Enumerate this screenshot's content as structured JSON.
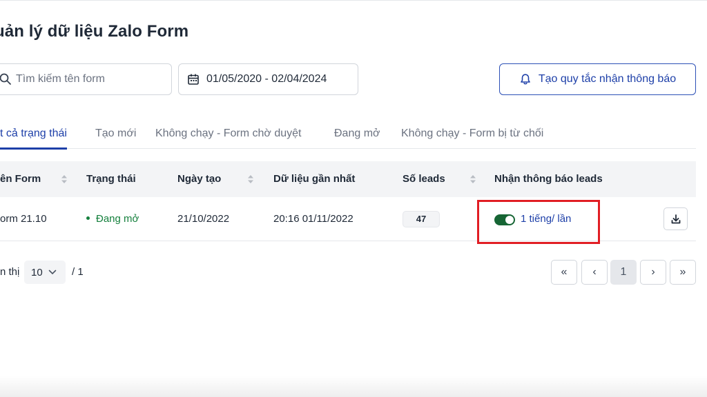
{
  "page": {
    "title": "uản lý dữ liệu Zalo Form"
  },
  "search": {
    "placeholder": "Tìm kiếm tên form",
    "value": ""
  },
  "date_range": {
    "value": "01/05/2020 - 02/04/2024"
  },
  "notify_button": {
    "label": "Tạo quy tắc nhận thông báo"
  },
  "tabs": [
    {
      "label": "t cả trạng thái",
      "active": true
    },
    {
      "label": "Tạo mới",
      "active": false
    },
    {
      "label": "Không chạy - Form chờ duyệt",
      "active": false
    },
    {
      "label": "Đang mở",
      "active": false
    },
    {
      "label": "Không chạy - Form bị từ chối",
      "active": false
    }
  ],
  "table": {
    "headers": [
      "ên Form",
      "Trạng thái",
      "Ngày tạo",
      "Dữ liệu gần nhất",
      "Số leads",
      "Nhận thông báo leads"
    ],
    "rows": [
      {
        "form_name": "orm 21.10",
        "status": "Đang mở",
        "created": "21/10/2022",
        "latest_data": "20:16 01/11/2022",
        "leads": "47",
        "notify_enabled": true,
        "notify_frequency": "1 tiếng/ lần"
      }
    ]
  },
  "pagination": {
    "label": "n thị",
    "page_size": "10",
    "total": "/ 1",
    "current_page": "1",
    "first": "«",
    "prev": "‹",
    "next": "›",
    "last": "»"
  },
  "colors": {
    "primary": "#1d3fa8",
    "status_green": "#15803d",
    "toggle_on": "#166534",
    "highlight": "#e11d24"
  },
  "icons": [
    "search-icon",
    "calendar-icon",
    "bell-icon",
    "sort-icon",
    "download-icon",
    "chevron-down-icon"
  ]
}
